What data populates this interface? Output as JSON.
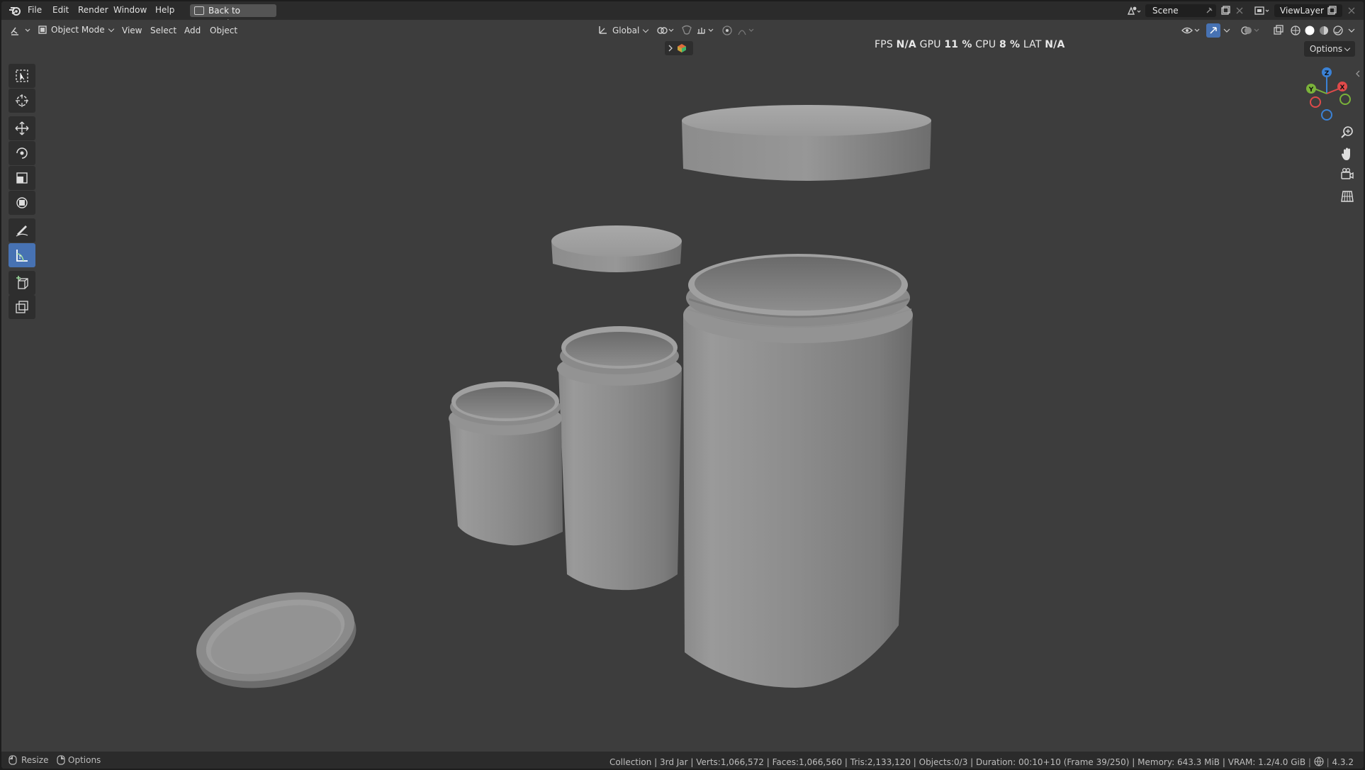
{
  "menu": {
    "file": "File",
    "edit": "Edit",
    "render": "Render",
    "window": "Window",
    "help": "Help",
    "back": "Back to Previous"
  },
  "scene": {
    "scene_label": "Scene",
    "viewlayer_label": "ViewLayer"
  },
  "header": {
    "mode": "Object Mode",
    "view": "View",
    "select": "Select",
    "add": "Add",
    "object": "Object",
    "orientation": "Global",
    "options": "Options"
  },
  "stats": {
    "fps_label": "FPS",
    "fps_value": "N/A",
    "gpu_label": "GPU",
    "gpu_value": "11 %",
    "cpu_label": "CPU",
    "cpu_value": "8 %",
    "lat_label": "LAT",
    "lat_value": "N/A"
  },
  "gizmo": {
    "z": "Z",
    "y": "Y",
    "x": "X"
  },
  "status": {
    "resize": "Resize",
    "options": "Options",
    "info": "Collection | 3rd Jar | Verts:1,066,572 | Faces:1,066,560 | Tris:2,133,120 | Objects:0/3 | Duration: 00:10+10 (Frame 39/250) | Memory: 643.3 MiB | VRAM: 1.2/4.0 GiB",
    "version": "4.3.2"
  },
  "colors": {
    "accent": "#4772b3",
    "viewport": "#3d3d3d",
    "axis_x": "#e04a4a",
    "axis_y": "#7bb33a",
    "axis_z": "#3b82d6"
  }
}
